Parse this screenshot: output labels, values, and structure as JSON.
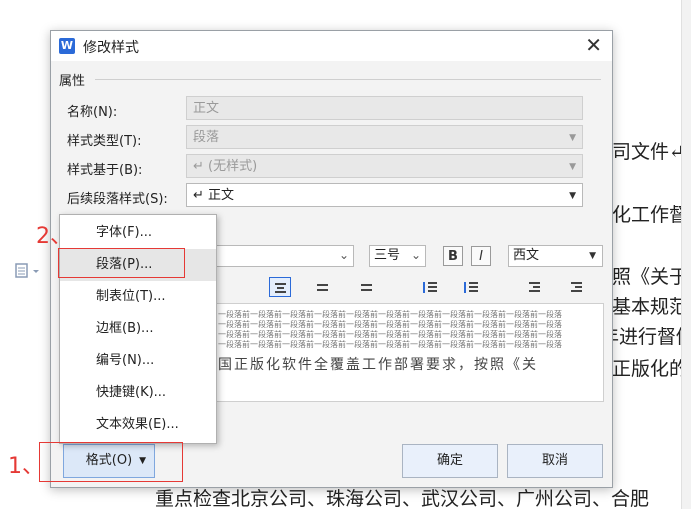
{
  "dialog": {
    "app_icon": "W",
    "title": "修改样式",
    "close": "✕",
    "section": "属性",
    "name_label": "名称(N):",
    "name_value": "正文",
    "type_label": "样式类型(T):",
    "type_value": "段落",
    "based_label": "样式基于(B):",
    "based_value": "↵  (无样式)",
    "next_label": "后续段落样式(S):",
    "next_value": "↵  正文",
    "font_size": "三号",
    "bold": "B",
    "italic": "I",
    "script": "西文",
    "preview_line": "一段落前一段落前一段落前一段落前一段落前一段落前一段落前一段落前一段落前一段落前一段落",
    "preview_text": "国正版化软件全覆盖工作部署要求，按照《关",
    "ok": "确定",
    "cancel": "取消",
    "format": "格式(O)"
  },
  "menu": {
    "items": [
      "字体(F)...",
      "段落(P)...",
      "制表位(T)...",
      "边框(B)...",
      "编号(N)...",
      "快捷键(K)...",
      "文本效果(E)..."
    ]
  },
  "annotations": {
    "one": "1、",
    "two": "2、"
  },
  "document": {
    "line1": "司文件↵",
    "line2": "化工作督",
    "line3": "照《关于",
    "line4": "基本规范",
    "line5": "年进行督促",
    "line6": "正版化的",
    "bottom": "重点检查北京公司、珠海公司、武汉公司、广州公司、合肥"
  }
}
